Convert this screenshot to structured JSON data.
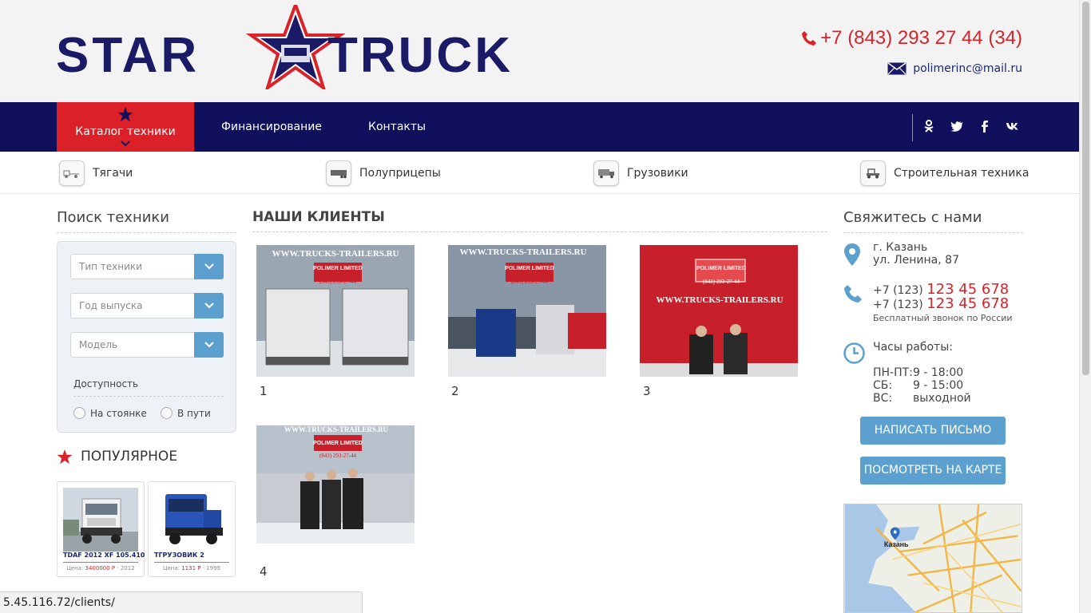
{
  "header": {
    "logo_left": "STAR",
    "logo_right": "TRUCK",
    "phone": "+7 (843) 293 27 44 (34)",
    "email": "polimerinc@mail.ru"
  },
  "nav": {
    "catalog": "Каталог техники",
    "financing": "Финансирование",
    "contacts": "Контакты",
    "social": [
      "odnoklassniki-icon",
      "twitter-icon",
      "facebook-icon",
      "vk-icon"
    ]
  },
  "categories": [
    {
      "label": "Тягачи",
      "icon": "tractor-truck-icon"
    },
    {
      "label": "Полуприцепы",
      "icon": "semitrailer-icon"
    },
    {
      "label": "Грузовики",
      "icon": "truck-icon"
    },
    {
      "label": "Строительная техника",
      "icon": "construction-icon"
    }
  ],
  "search": {
    "title": "Поиск техники",
    "type_placeholder": "Тип техники",
    "year_placeholder": "Год выпуска",
    "model_placeholder": "Модель",
    "availability": "Доступность",
    "parked": "На стоянке",
    "in_transit": "В пути"
  },
  "popular": {
    "title": "ПОПУЛЯРНОЕ",
    "items": [
      {
        "name": "TDAF 2012 XF 105.410",
        "price_label": "Цена:",
        "price": "3400000 Р",
        "year": "· 2012"
      },
      {
        "name": "TГРУЗОВИК 2",
        "price_label": "Цена:",
        "price": "1131 Р",
        "year": "· 1999"
      }
    ]
  },
  "clients": {
    "title": "НАШИ КЛИЕНТЫ",
    "watermark_url": "WWW.TRUCKS-TRAILERS.RU",
    "watermark_company": "POLIMER LIMITED",
    "watermark_phone": "(843) 293-27-44",
    "items": [
      "1",
      "2",
      "3",
      "4"
    ]
  },
  "contact": {
    "title": "Свяжитесь с нами",
    "city": "г. Казань",
    "street": "ул. Ленина, 87",
    "phone_prefix1": "+7 (123) ",
    "phone_main1": "123 45 678",
    "phone_prefix2": "+7 (123) ",
    "phone_main2": "123 45 678",
    "free_call": "Бесплатный звонок по России",
    "hours_title": "Часы работы:",
    "hours": [
      {
        "day": "ПН-ПТ:",
        "time": "9 - 18:00"
      },
      {
        "day": "СБ:",
        "time": "9 - 15:00"
      },
      {
        "day": "ВС:",
        "time": "выходной"
      }
    ],
    "write_btn": "НАПИСАТЬ ПИСЬМО",
    "map_btn": "ПОСМОТРЕТЬ НА КАРТЕ",
    "map_label": "Казань"
  },
  "status_url": "5.45.116.72/clients/",
  "colors": {
    "navy": "#0f0f5c",
    "red": "#dc2027",
    "blue_button": "#5ba0cf"
  }
}
